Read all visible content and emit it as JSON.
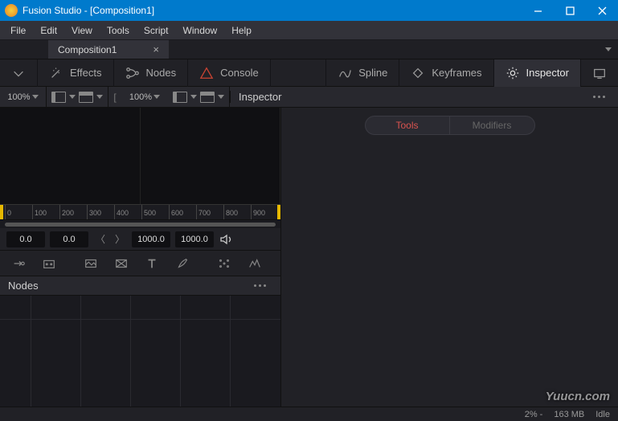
{
  "title": "Fusion Studio - [Composition1]",
  "menu": [
    "File",
    "Edit",
    "View",
    "Tools",
    "Script",
    "Window",
    "Help"
  ],
  "tab": {
    "name": "Composition1"
  },
  "workspaces": {
    "effects": "Effects",
    "nodes": "Nodes",
    "console": "Console",
    "spline": "Spline",
    "keyframes": "Keyframes",
    "inspector": "Inspector"
  },
  "zoom": {
    "left": "100%",
    "right": "100%"
  },
  "panel": {
    "inspector": "Inspector",
    "nodes": "Nodes"
  },
  "ruler_ticks": [
    "0",
    "100",
    "200",
    "300",
    "400",
    "500",
    "600",
    "700",
    "800",
    "900"
  ],
  "time": {
    "start": "0.0",
    "current": "0.0",
    "end": "1000.0",
    "range_end": "1000.0"
  },
  "inspector_tabs": {
    "tools": "Tools",
    "modifiers": "Modifiers"
  },
  "status": {
    "pct": "2% -",
    "mem": "163 MB",
    "state": "Idle"
  },
  "watermark": "Yuucn.com"
}
